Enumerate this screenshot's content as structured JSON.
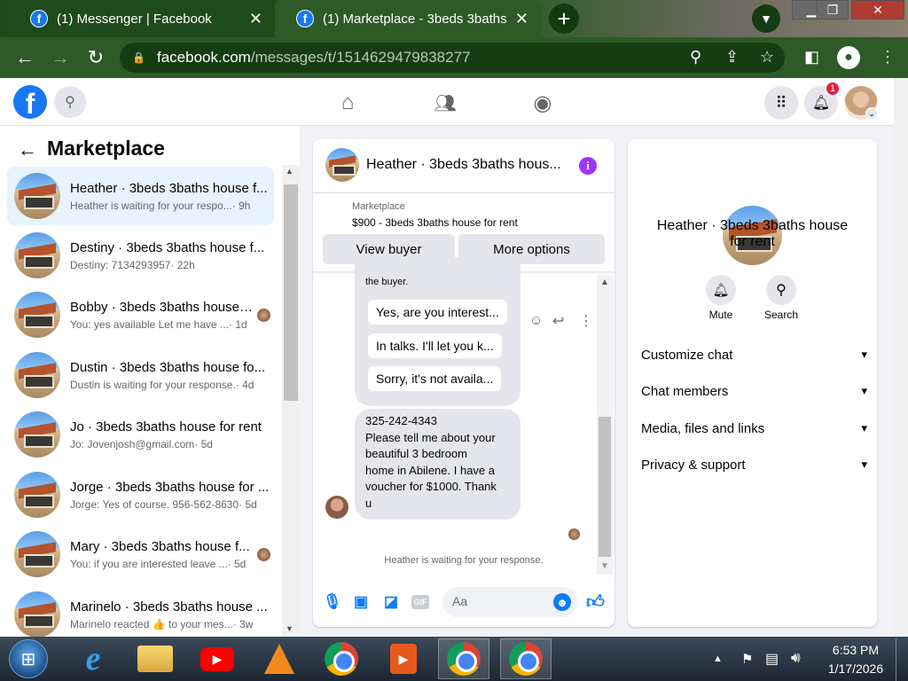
{
  "browser": {
    "tabs": [
      {
        "title": "(1) Messenger | Facebook",
        "close": "✕"
      },
      {
        "title": "(1) Marketplace - 3beds 3baths h",
        "close": "✕"
      }
    ],
    "new_tab": "+",
    "url_host": "facebook.com",
    "url_path": "/messages/t/1514629479838277"
  },
  "fb": {
    "logo": "f",
    "notifications_badge": "1"
  },
  "left": {
    "back": "←",
    "title": "Marketplace",
    "conversations": [
      {
        "name": "Heather · 3beds 3baths house f...",
        "snippet": "Heather is waiting for your respo...",
        "time": " · 9h",
        "avatar": false
      },
      {
        "name": "Destiny · 3beds 3baths house f...",
        "snippet": "Destiny: 7134293957",
        "time": " · 22h",
        "avatar": false
      },
      {
        "name": "Bobby · 3beds 3baths house ...",
        "snippet": "You: yes available Let me have ...",
        "time": " · 1d",
        "avatar": true
      },
      {
        "name": "Dustin · 3beds 3baths house fo...",
        "snippet": "Dustin is waiting for your response.",
        "time": " · 4d",
        "avatar": false
      },
      {
        "name": "Jo · 3beds 3baths house for rent",
        "snippet": "Jo: Jovenjosh@gmail.com",
        "time": " · 5d",
        "avatar": false
      },
      {
        "name": "Jorge · 3beds 3baths house for ...",
        "snippet": "Jorge: Yes of course. 956-562-8630",
        "time": " · 5d",
        "avatar": false
      },
      {
        "name": "Mary · 3beds 3baths house f...",
        "snippet": "You: if you are interested leave ...",
        "time": " · 5d",
        "avatar": true
      },
      {
        "name": "Marinelo · 3beds 3baths house ...",
        "snippet": "Marinelo reacted 👍 to your mes...",
        "time": " · 3w",
        "avatar": false
      }
    ]
  },
  "chat": {
    "header_title": "Heather · 3beds 3baths hous...",
    "info_icon": "i",
    "listing_label": "Marketplace",
    "listing_title": "$900 - 3beds 3baths house for rent",
    "view_buyer": "View buyer",
    "more_options": "More options",
    "partial_text": "the buyer.",
    "quick_replies": [
      "Yes, are you interest...",
      "In talks. I'll let you k...",
      "Sorry, it's not availa..."
    ],
    "message_lines": [
      "325-242-4343",
      "Please tell me about your",
      "beautiful 3 bedroom",
      "home in Abilene. I have a",
      "voucher for $1000. Thank",
      "u"
    ],
    "waiting": "Heather is waiting for your response.",
    "composer_placeholder": "Aa",
    "gif_label": "GIF"
  },
  "details": {
    "title_line1": "Heather · 3beds 3baths house",
    "title_line2": "for rent",
    "mute": "Mute",
    "search": "Search",
    "menu": [
      "Customize chat",
      "Chat members",
      "Media, files and links",
      "Privacy & support"
    ]
  },
  "taskbar": {
    "time": "6:53 PM",
    "date": "1/17/2026"
  }
}
